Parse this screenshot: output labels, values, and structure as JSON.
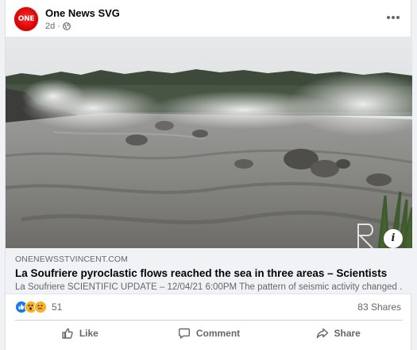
{
  "post": {
    "page_name": "One News SVG",
    "avatar_logo_text": "ONE",
    "age": "2d",
    "privacy_icon": "globe-icon",
    "more_icon": "more-horizontal-icon"
  },
  "link": {
    "domain": "ONENEWSSTVINCENT.COM",
    "title": "La Soufriere pyroclastic flows reached the sea in three areas – Scientists",
    "description": "La Soufriere SCIENTIFIC UPDATE – 12/04/21 6:00PM The pattern of seismic activity changed ...",
    "info_icon": "info-icon"
  },
  "engagement": {
    "reaction_icons": [
      "like-reaction-icon",
      "wow-reaction-icon",
      "sad-reaction-icon"
    ],
    "reaction_count": "51",
    "shares": "83 Shares"
  },
  "actions": {
    "like_label": "Like",
    "comment_label": "Comment",
    "share_label": "Share"
  },
  "colors": {
    "brand_red": "#d40000",
    "like_blue": "#1877f2",
    "reaction_yellow": "#f7b125",
    "secondary_text": "#65676b",
    "link_preview_bg": "#f0f2f5"
  }
}
